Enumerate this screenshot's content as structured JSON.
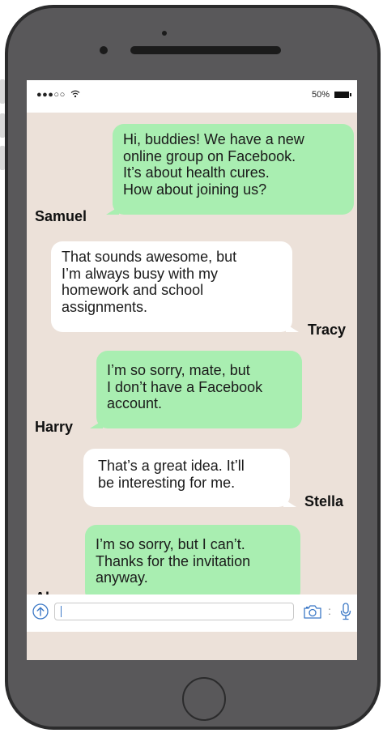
{
  "status_bar": {
    "signal": "●●●○○",
    "wifi_icon": "wifi-icon",
    "battery_percent": "50%",
    "battery_icon": "battery-icon"
  },
  "messages": [
    {
      "sender": "Samuel",
      "style": "green",
      "lines": [
        "Hi, buddies! We have a new",
        "online group on Facebook.",
        "It’s about health cures.",
        "How about joining us?"
      ]
    },
    {
      "sender": "Tracy",
      "style": "white",
      "lines": [
        "That sounds awesome, but",
        "I’m always busy with my",
        "homework and school",
        "assignments."
      ]
    },
    {
      "sender": "Harry",
      "style": "green",
      "lines": [
        "I’m so sorry, mate, but",
        "I don’t have a Facebook",
        "account."
      ]
    },
    {
      "sender": "Stella",
      "style": "white",
      "lines": [
        "That’s a great idea. It’ll",
        "be interesting for me."
      ]
    },
    {
      "sender": "Alex",
      "style": "green",
      "lines": [
        "I’m so sorry, but I can’t.",
        "Thanks for the invitation",
        "anyway."
      ]
    }
  ],
  "input_bar": {
    "value": "",
    "placeholder": "",
    "icons": [
      "upload-arrow-icon",
      "camera-icon",
      "microphone-icon"
    ],
    "separator": ":"
  },
  "colors": {
    "screen_bg": "#ece1d9",
    "green_bubble": "#a9eeb1",
    "white_bubble": "#ffffff",
    "phone_body": "#59585a",
    "accent_blue": "#3b78c6"
  }
}
